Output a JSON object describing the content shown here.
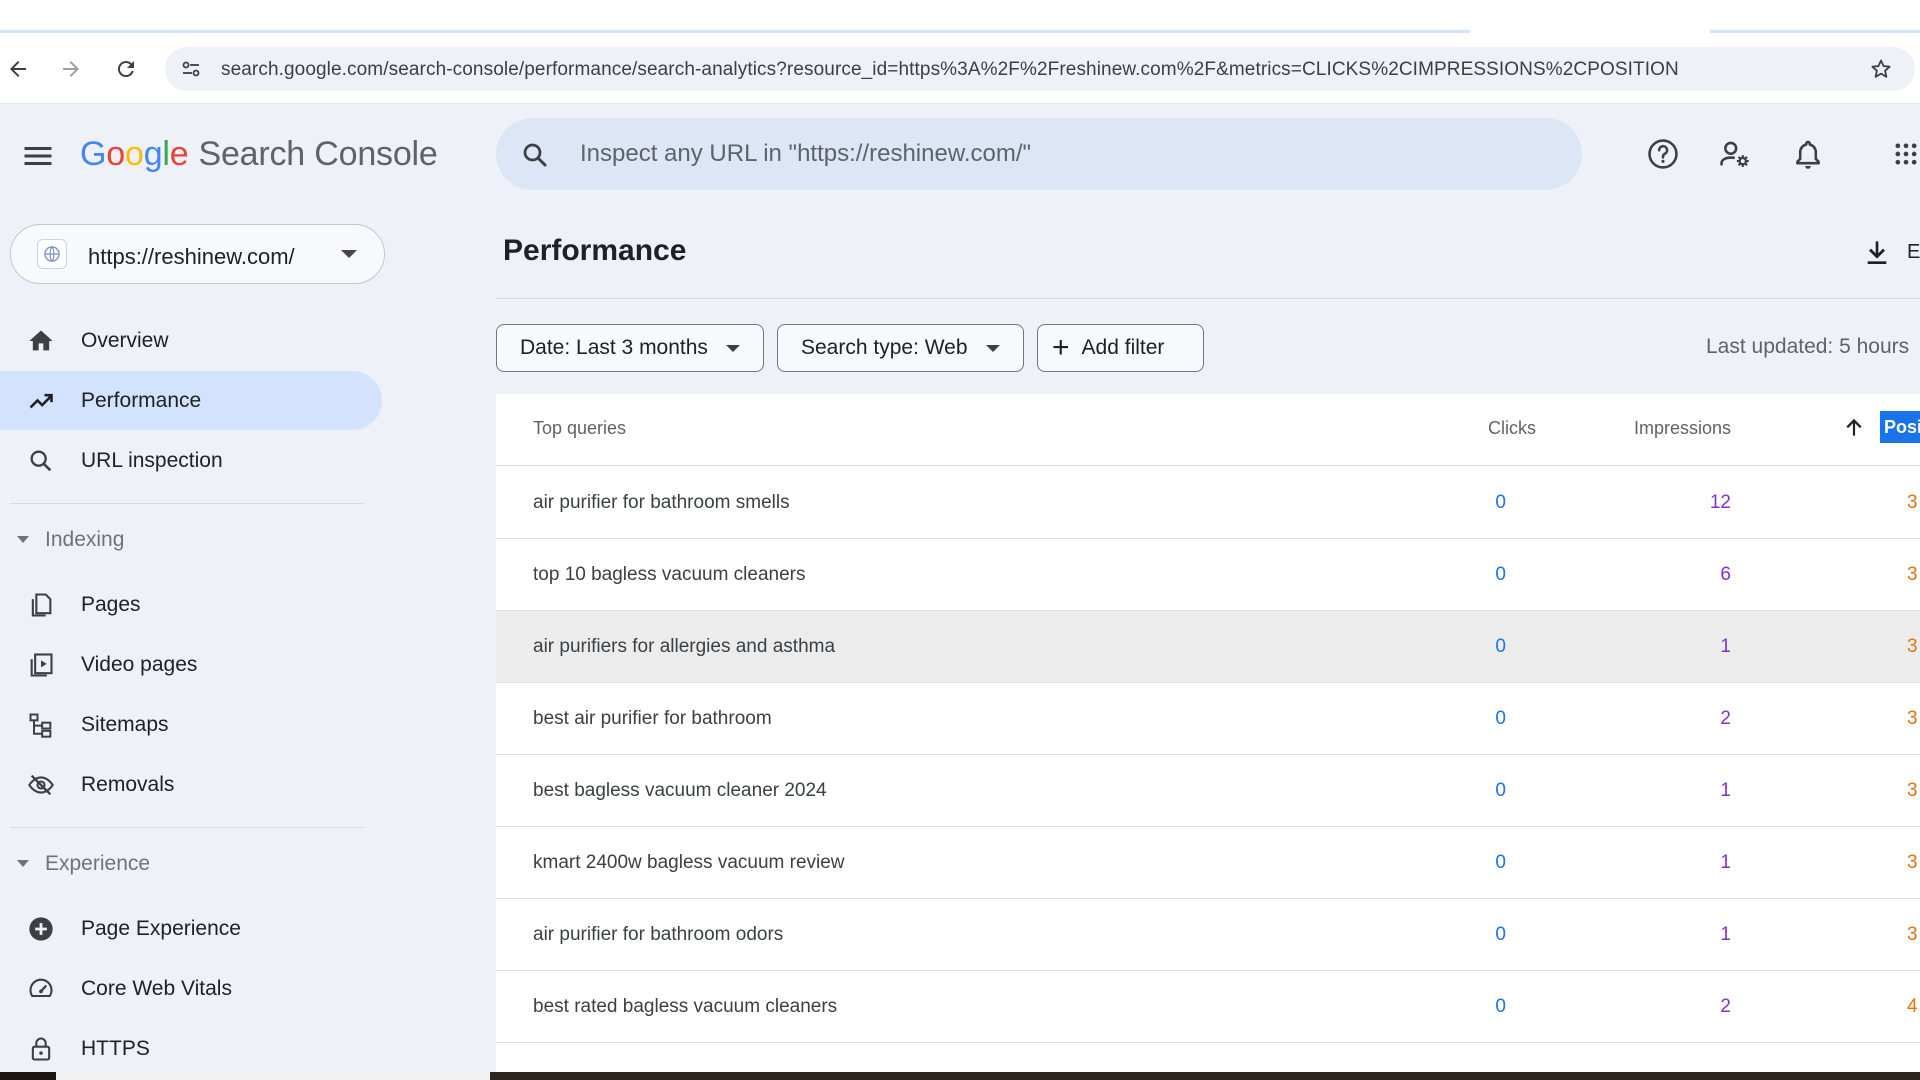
{
  "browser": {
    "url": "search.google.com/search-console/performance/search-analytics?resource_id=https%3A%2F%2Freshinew.com%2F&metrics=CLICKS%2CIMPRESSIONS%2CPOSITION"
  },
  "header": {
    "logo_google": "Google",
    "logo_product": "Search Console",
    "search_placeholder": "Inspect any URL in \"https://reshinew.com/\""
  },
  "sidebar": {
    "property": "https://reshinew.com/",
    "nav": [
      {
        "label": "Overview",
        "icon": "home-icon"
      },
      {
        "label": "Performance",
        "icon": "trending-up-icon",
        "active": true
      },
      {
        "label": "URL inspection",
        "icon": "search-icon"
      }
    ],
    "indexing": {
      "title": "Indexing",
      "items": [
        {
          "label": "Pages",
          "icon": "pages-icon"
        },
        {
          "label": "Video pages",
          "icon": "video-pages-icon"
        },
        {
          "label": "Sitemaps",
          "icon": "sitemap-icon"
        },
        {
          "label": "Removals",
          "icon": "eye-off-icon"
        }
      ]
    },
    "experience": {
      "title": "Experience",
      "items": [
        {
          "label": "Page Experience",
          "icon": "plus-circle-icon"
        },
        {
          "label": "Core Web Vitals",
          "icon": "gauge-icon"
        },
        {
          "label": "HTTPS",
          "icon": "lock-icon"
        }
      ]
    }
  },
  "main": {
    "title": "Performance",
    "export_label": "E",
    "filters": {
      "date": "Date: Last 3 months",
      "search_type": "Search type: Web",
      "add_filter": "Add filter"
    },
    "last_updated": "Last updated: 5 hours",
    "table": {
      "columns": {
        "query": "Top queries",
        "clicks": "Clicks",
        "impressions": "Impressions",
        "position": "Posit"
      },
      "rows": [
        {
          "query": "air purifier for bathroom smells",
          "clicks": "0",
          "impressions": "12",
          "position": "3"
        },
        {
          "query": "top 10 bagless vacuum cleaners",
          "clicks": "0",
          "impressions": "6",
          "position": "3"
        },
        {
          "query": "air purifiers for allergies and asthma",
          "clicks": "0",
          "impressions": "1",
          "position": "3"
        },
        {
          "query": "best air purifier for bathroom",
          "clicks": "0",
          "impressions": "2",
          "position": "3"
        },
        {
          "query": "best bagless vacuum cleaner 2024",
          "clicks": "0",
          "impressions": "1",
          "position": "3"
        },
        {
          "query": "kmart 2400w bagless vacuum review",
          "clicks": "0",
          "impressions": "1",
          "position": "3"
        },
        {
          "query": "air purifier for bathroom odors",
          "clicks": "0",
          "impressions": "1",
          "position": "3"
        },
        {
          "query": "best rated bagless vacuum cleaners",
          "clicks": "0",
          "impressions": "2",
          "position": "4"
        }
      ]
    }
  },
  "colors": {
    "clicks": "#1a73e8",
    "impressions": "#8430ce",
    "position": "#e8710a",
    "active_nav": "#d3e3fd"
  }
}
